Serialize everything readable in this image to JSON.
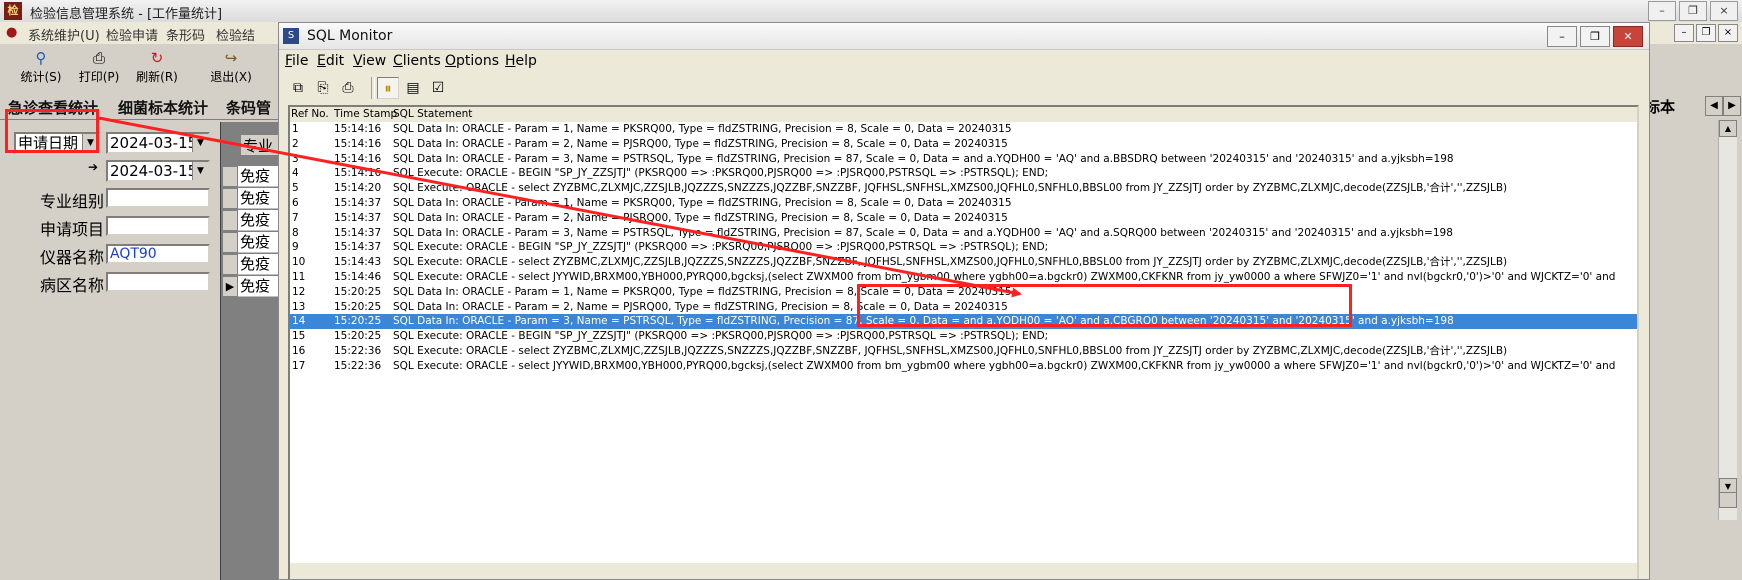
{
  "app": {
    "title": "检验信息管理系统 - [工作量统计]",
    "icon_text": "检",
    "menus": [
      "系统维护(U)",
      "检验申请",
      "条形码",
      "检验结"
    ],
    "window_buttons": [
      "–",
      "❐",
      "×"
    ],
    "mdi_buttons": [
      "–",
      "❐",
      "×"
    ],
    "toolbar": [
      {
        "label": "统计(S)",
        "icon": "search-icon",
        "glyph": "⚲"
      },
      {
        "label": "打印(P)",
        "icon": "printer-icon",
        "glyph": "⎙"
      },
      {
        "label": "刷新(R)",
        "icon": "refresh-icon",
        "glyph": "↻"
      },
      {
        "label": "退出(X)",
        "icon": "exit-icon",
        "glyph": "↪"
      }
    ],
    "tabs": [
      "急诊查看统计",
      "细菌标本统计",
      "条码管"
    ],
    "tabs_right_label": "标本",
    "form": {
      "date_type": "申请日期",
      "date_from": "2024-03-15",
      "date_to": "2024-03-15",
      "group_label": "专业组别",
      "item_label": "申请项目",
      "instrument_label": "仪器名称",
      "instrument_value": "AQT90",
      "ward_label": "病区名称"
    },
    "grid": {
      "header": "专业",
      "cells": [
        "免疫",
        "免疫",
        "免疫",
        "免疫",
        "免疫",
        "免疫"
      ],
      "current_row_indicator": "▶"
    }
  },
  "sql_monitor": {
    "title": "SQL Monitor",
    "icon_text": "S",
    "window_buttons": [
      "–",
      "❐",
      "✕"
    ],
    "menus": [
      {
        "label": "File",
        "underline": "F",
        "rest": "ile"
      },
      {
        "label": "Edit",
        "underline": "E",
        "rest": "dit"
      },
      {
        "label": "View",
        "underline": "V",
        "rest": "iew"
      },
      {
        "label": "Clients",
        "underline": "C",
        "rest": "lients"
      },
      {
        "label": "Options",
        "underline": "O",
        "rest": "ptions"
      },
      {
        "label": "Help",
        "underline": "H",
        "rest": "elp"
      }
    ],
    "toolbar_icons": [
      "copy-to-window-icon",
      "copy-icon",
      "print-icon",
      "pause-icon",
      "tile-windows-icon",
      "checklist-icon"
    ],
    "toolbar_glyphs": [
      "⧉",
      "⎘",
      "⎙",
      "⏸",
      "▤",
      "☑"
    ],
    "columns": [
      "Ref No.",
      "Time Stamp",
      "SQL Statement"
    ],
    "selected_ref": "14",
    "rows": [
      {
        "ref": "1",
        "time": "15:14:16",
        "sql": "SQL Data In: ORACLE - Param = 1, Name = PKSRQ00, Type = fldZSTRING, Precision = 8, Scale = 0, Data = 20240315"
      },
      {
        "ref": "2",
        "time": "15:14:16",
        "sql": "SQL Data In: ORACLE - Param = 2, Name = PJSRQ00, Type = fldZSTRING, Precision = 8, Scale = 0, Data = 20240315"
      },
      {
        "ref": "3",
        "time": "15:14:16",
        "sql": "SQL Data In: ORACLE - Param = 3, Name = PSTRSQL, Type = fldZSTRING, Precision = 87, Scale = 0, Data =  and a.YQDH00 = 'AQ'  and a.BBSDRQ between '20240315' and '20240315'  and a.yjksbh=198"
      },
      {
        "ref": "4",
        "time": "15:14:16",
        "sql": "SQL Execute: ORACLE - BEGIN \"SP_JY_ZZSJTJ\" (PKSRQ00 => :PKSRQ00,PJSRQ00 => :PJSRQ00,PSTRSQL => :PSTRSQL); END;"
      },
      {
        "ref": "5",
        "time": "15:14:20",
        "sql": "SQL Execute: ORACLE -  select ZYZBMC,ZLXMJC,ZZSJLB,JQZZZS,SNZZZS,JQZZBF,SNZZBF,          JQFHSL,SNFHSL,XMZS00,JQFHL0,SNFHL0,BBSL00  from JY_ZZSJTJ  order by ZYZBMC,ZLXMJC,decode(ZZSJLB,'合计','',ZZSJLB)"
      },
      {
        "ref": "6",
        "time": "15:14:37",
        "sql": "SQL Data In: ORACLE - Param = 1, Name = PKSRQ00, Type = fldZSTRING, Precision = 8, Scale = 0, Data = 20240315"
      },
      {
        "ref": "7",
        "time": "15:14:37",
        "sql": "SQL Data In: ORACLE - Param = 2, Name = PJSRQ00, Type = fldZSTRING, Precision = 8, Scale = 0, Data = 20240315"
      },
      {
        "ref": "8",
        "time": "15:14:37",
        "sql": "SQL Data In: ORACLE - Param = 3, Name = PSTRSQL, Type = fldZSTRING, Precision = 87, Scale = 0, Data =  and a.YQDH00 = 'AQ'  and a.SQRQ00 between '20240315' and '20240315'  and a.yjksbh=198"
      },
      {
        "ref": "9",
        "time": "15:14:37",
        "sql": "SQL Execute: ORACLE - BEGIN \"SP_JY_ZZSJTJ\" (PKSRQ00 => :PKSRQ00,PJSRQ00 => :PJSRQ00,PSTRSQL => :PSTRSQL); END;"
      },
      {
        "ref": "10",
        "time": "15:14:43",
        "sql": "SQL Execute: ORACLE -  select ZYZBMC,ZLXMJC,ZZSJLB,JQZZZS,SNZZZS,JQZZBF,SNZZBF,          JQFHSL,SNFHSL,XMZS00,JQFHL0,SNFHL0,BBSL00  from JY_ZZSJTJ  order by ZYZBMC,ZLXMJC,decode(ZZSJLB,'合计','',ZZSJLB)"
      },
      {
        "ref": "11",
        "time": "15:14:46",
        "sql": "SQL Execute: ORACLE -  select JYYWID,BRXM00,YBH000,PYRQ00,bgcksj,(select ZWXM00 from bm_ygbm00 where ygbh00=a.bgckr0) ZWXM00,CKFKNR  from  jy_yw0000 a where SFWJZ0='1'  and  nvl(bgckr0,'0')>'0' and WJCKTZ='0' and"
      },
      {
        "ref": "12",
        "time": "15:20:25",
        "sql": "SQL Data In: ORACLE - Param = 1, Name = PKSRQ00, Type = fldZSTRING, Precision = 8, Scale = 0, Data = 20240315"
      },
      {
        "ref": "13",
        "time": "15:20:25",
        "sql": "SQL Data In: ORACLE - Param = 2, Name = PJSRQ00, Type = fldZSTRING, Precision = 8, Scale = 0, Data = 20240315"
      },
      {
        "ref": "14",
        "time": "15:20:25",
        "sql": "SQL Data In: ORACLE - Param = 3, Name = PSTRSQL, Type = fldZSTRING, Precision = 87, Scale = 0, Data =  and a.YQDH00 = 'AQ'  and a.CBGRQ0 between '20240315' and '20240315'  and a.yjksbh=198"
      },
      {
        "ref": "15",
        "time": "15:20:25",
        "sql": "SQL Execute: ORACLE - BEGIN \"SP_JY_ZZSJTJ\" (PKSRQ00 => :PKSRQ00,PJSRQ00 => :PJSRQ00,PSTRSQL => :PSTRSQL); END;"
      },
      {
        "ref": "16",
        "time": "15:22:36",
        "sql": "SQL Execute: ORACLE -  select ZYZBMC,ZLXMJC,ZZSJLB,JQZZZS,SNZZZS,JQZZBF,SNZZBF,          JQFHSL,SNFHSL,XMZS00,JQFHL0,SNFHL0,BBSL00  from JY_ZZSJTJ  order by ZYZBMC,ZLXMJC,decode(ZZSJLB,'合计','',ZZSJLB)"
      },
      {
        "ref": "17",
        "time": "15:22:36",
        "sql": "SQL Execute: ORACLE -  select JYYWID,BRXM00,YBH000,PYRQ00,bgcksj,(select ZWXM00 from bm_ygbm00 where ygbh00=a.bgckr0) ZWXM00,CKFKNR  from  jy_yw0000 a where SFWJZ0='1'  and  nvl(bgckr0,'0')>'0' and WJCKTZ='0' and"
      }
    ]
  },
  "colors": {
    "annotation": "#ff2020",
    "selection": "#3b86d6",
    "window_bg": "#ece9d8"
  }
}
